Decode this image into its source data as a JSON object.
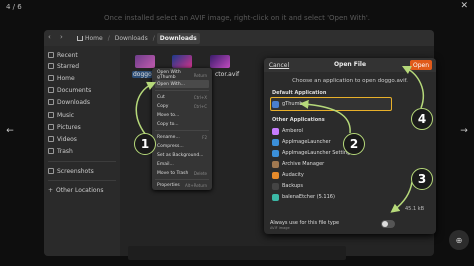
{
  "viewer": {
    "counter": "4 / 6",
    "caption": "Once installed select an AVIF image, right-click on it and select 'Open With'."
  },
  "path": [
    "Home",
    "Downloads",
    "Downloads"
  ],
  "sidebar": {
    "items": [
      {
        "label": "Recent",
        "icon": "clock-icon"
      },
      {
        "label": "Starred",
        "icon": "star-icon"
      },
      {
        "label": "Home",
        "icon": "home-icon"
      },
      {
        "label": "Documents",
        "icon": "document-icon"
      },
      {
        "label": "Downloads",
        "icon": "download-icon"
      },
      {
        "label": "Music",
        "icon": "music-icon"
      },
      {
        "label": "Pictures",
        "icon": "picture-icon"
      },
      {
        "label": "Videos",
        "icon": "video-icon"
      },
      {
        "label": "Trash",
        "icon": "trash-icon"
      },
      {
        "label": "Screenshots",
        "icon": "folder-icon"
      },
      {
        "label": "Other Locations",
        "icon": "plus-icon"
      }
    ]
  },
  "files": [
    {
      "label": "doggo.av",
      "selected": true
    },
    {
      "label": "",
      "selected": false
    },
    {
      "label": "ctor.avif",
      "selected": false
    }
  ],
  "context_menu": {
    "items": [
      {
        "label": "Open With gThumb",
        "hint": "Return"
      },
      {
        "label": "Open With...",
        "hint": ""
      },
      {
        "label": "Cut",
        "hint": "Ctrl+X"
      },
      {
        "label": "Copy",
        "hint": "Ctrl+C"
      },
      {
        "label": "Move to...",
        "hint": ""
      },
      {
        "label": "Copy to...",
        "hint": ""
      },
      {
        "label": "Rename...",
        "hint": "F2"
      },
      {
        "label": "Compress...",
        "hint": ""
      },
      {
        "label": "Set as Background...",
        "hint": ""
      },
      {
        "label": "Email...",
        "hint": ""
      },
      {
        "label": "Move to Trash",
        "hint": "Delete"
      },
      {
        "label": "Properties",
        "hint": "Alt+Return"
      }
    ]
  },
  "dialog": {
    "cancel": "Cancel",
    "title": "Open File",
    "open": "Open",
    "subtitle": "Choose an application to open doggo.avif.",
    "default_head": "Default Application",
    "default_app": "gThumb",
    "other_head": "Other Applications",
    "apps": [
      {
        "label": "Amberol",
        "color": "#c77dff"
      },
      {
        "label": "AppImageLauncher",
        "color": "#3b8fd9"
      },
      {
        "label": "AppImageLauncher Settings",
        "color": "#3b8fd9"
      },
      {
        "label": "Archive Manager",
        "color": "#a07850"
      },
      {
        "label": "Audacity",
        "color": "#e58a2a"
      },
      {
        "label": "Backups",
        "color": "#444444"
      },
      {
        "label": "balenaEtcher (5.116)",
        "color": "#3bb8a6"
      }
    ],
    "always_label": "Always use for this file type",
    "always_sub": "AVIF image",
    "size": "45.1 kB"
  },
  "steps": [
    "1",
    "2",
    "3",
    "4"
  ],
  "colors": {
    "accent_open": "#e05a1a",
    "callout": "#b6d97a",
    "highlight_box": "#e8b02a"
  }
}
